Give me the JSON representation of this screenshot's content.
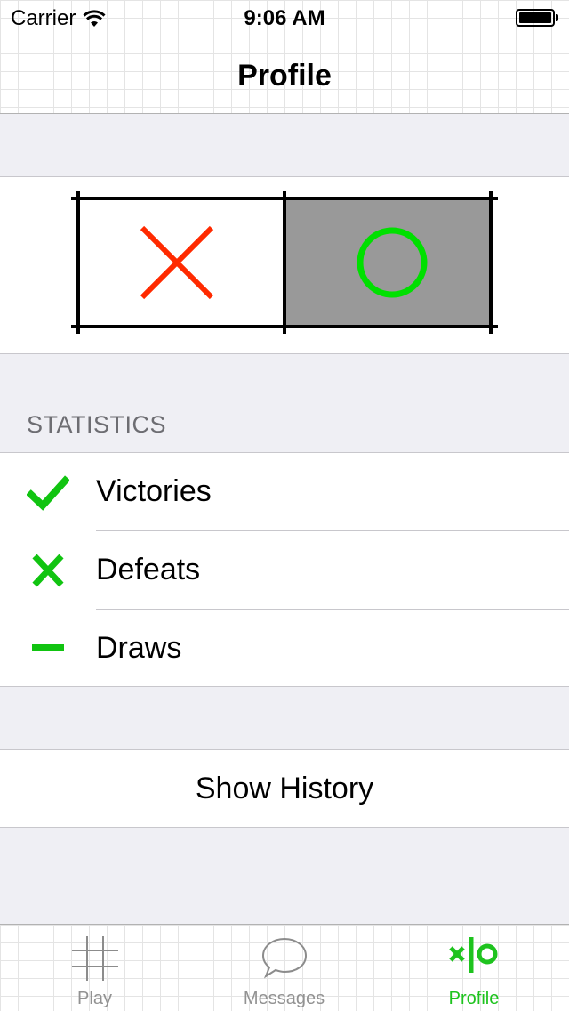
{
  "status_bar": {
    "carrier": "Carrier",
    "time": "9:06 AM"
  },
  "nav": {
    "title": "Profile"
  },
  "board": {
    "left_mark": "X",
    "right_mark": "O",
    "x_color": "#ff2a00",
    "o_color": "#00e000",
    "highlight_color": "#999999"
  },
  "statistics": {
    "header": "STATISTICS",
    "items": [
      {
        "label": "Victories",
        "icon": "checkmark-icon"
      },
      {
        "label": "Defeats",
        "icon": "cross-icon"
      },
      {
        "label": "Draws",
        "icon": "minus-icon"
      }
    ],
    "icon_color": "#11c411"
  },
  "history": {
    "button_label": "Show History"
  },
  "tab_bar": {
    "tabs": [
      {
        "label": "Play",
        "icon": "grid-icon",
        "active": false
      },
      {
        "label": "Messages",
        "icon": "speech-bubble-icon",
        "active": false
      },
      {
        "label": "Profile",
        "icon": "xo-icon",
        "active": true
      }
    ],
    "active_color": "#1ec31e",
    "inactive_color": "#929292"
  }
}
